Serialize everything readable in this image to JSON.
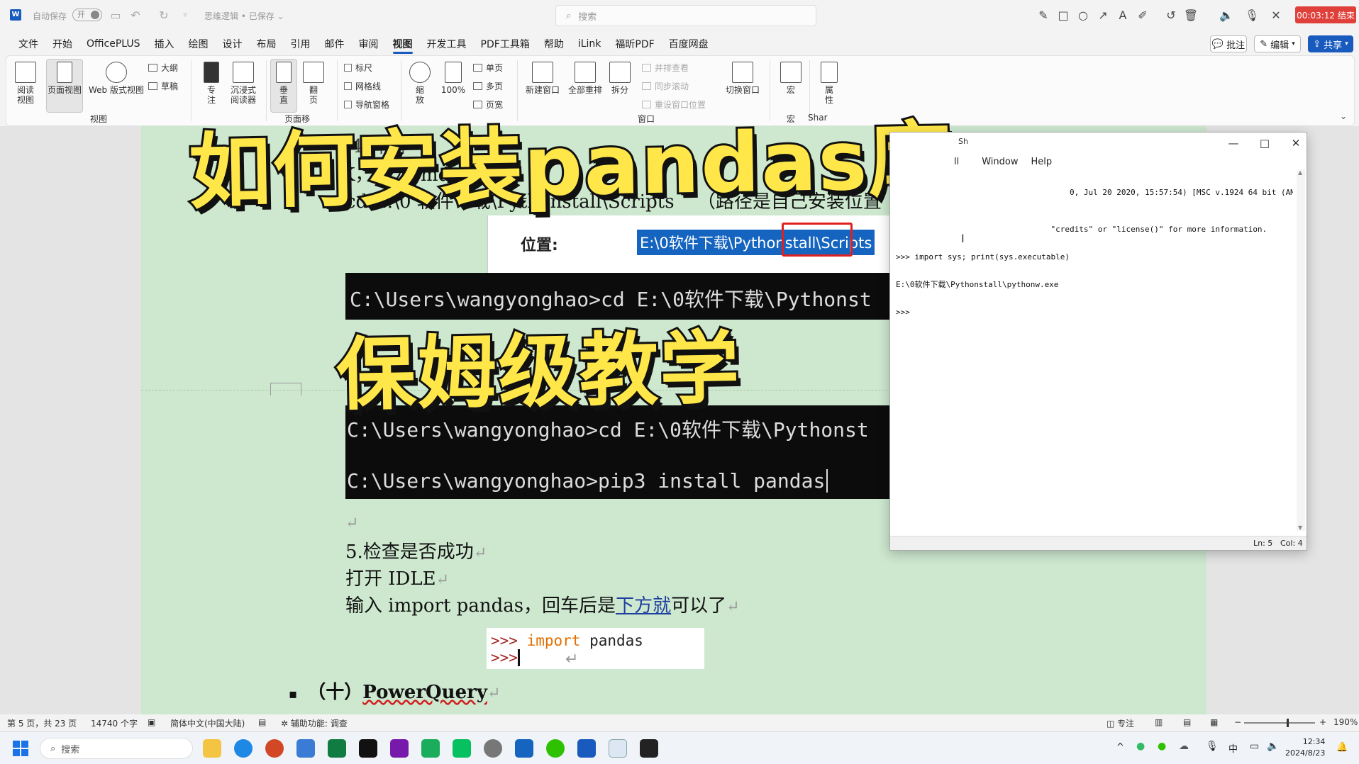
{
  "titlebar": {
    "autosave_label": "自动保存",
    "autosave_toggle": "开",
    "doc_title": "思维逻辑 • 已保存 ⌄",
    "search_placeholder": "搜索",
    "recording_timer": "00:03:12 结束"
  },
  "menu": {
    "items": [
      "文件",
      "开始",
      "OfficePLUS",
      "插入",
      "绘图",
      "设计",
      "布局",
      "引用",
      "邮件",
      "审阅",
      "视图",
      "开发工具",
      "PDF工具箱",
      "帮助",
      "iLink",
      "福昕PDF",
      "百度网盘"
    ],
    "active": "视图",
    "comment_btn": "批注",
    "edit_btn": "编辑",
    "share_btn": "共享"
  },
  "ribbon": {
    "read_view": "阅读\n视图",
    "page_view": "页面视图",
    "web_view": "Web 版式视图",
    "outline": "大纲",
    "draft": "草稿",
    "group_view": "视图",
    "focus": "专\n注",
    "immersive": "沉浸式\n阅读器",
    "vertical": "垂\n直",
    "page_flip": "翻\n页",
    "group_page_move": "页面移",
    "ruler": "标尺",
    "gridlines": "网格线",
    "nav_pane": "导航窗格",
    "zoom": "缩\n放",
    "zoom100": "100%",
    "one_page": "单页",
    "multi_page": "多页",
    "page_width": "页宽",
    "new_window": "新建窗口",
    "arrange_all": "全部重排",
    "split": "拆分",
    "side_by_side": "并排查看",
    "sync_scroll": "同步滚动",
    "reset_window": "重设窗口位置",
    "switch_window": "切换窗口",
    "group_window": "窗口",
    "macros": "宏",
    "group_macros": "宏",
    "properties": "属\n性",
    "group_share": "Shar"
  },
  "document": {
    "line_cmd": "cd E:\\0 软件下载\\Pythonstall\\Scripts",
    "line_cmd_note": "（路径是自己安装位置",
    "line_top_a": "4.开始",
    "line_top_b": "K，输入cmd",
    "location_label": "位置:",
    "location_path": "E:\\0软件下载\\Pythonstall\\Scripts",
    "term1_line": "C:\\Users\\wangyonghao>cd E:\\0软件下载\\Pythonst",
    "term2_line1": "C:\\Users\\wangyonghao>cd E:\\0软件下载\\Pythonst",
    "term2_line2": "C:\\Users\\wangyonghao>pip3 install pandas",
    "step5": "5.检查是否成功",
    "open_idle": "打开 IDLE",
    "input_line_a": "输入 import pandas，回车后是",
    "input_line_link": "下方就",
    "input_line_b": "可以了",
    "idle_prompt1": ">>> ",
    "idle_kw": "import",
    "idle_mod": " pandas",
    "idle_prompt2": ">>> ",
    "heading10_a": "（十）",
    "heading10_b": "PowerQuery",
    "bullet": "▪",
    "ret": "↵"
  },
  "overlay": {
    "title1": "如何安装pandas库",
    "title2": "保姆级教学"
  },
  "idle": {
    "title_frag": "Sh",
    "menu_items": [
      "ll",
      "Window",
      "Help"
    ],
    "line1": "                                     0, Jul 20 2020, 15:57:54) [MSC v.1924 64 bit (AM",
    "line2": "                                 \"credits\" or \"license()\" for more information.",
    "line3": ">>> import sys; print(sys.executable)",
    "line4": "E:\\0软件下载\\Pythonstall\\pythonw.exe",
    "line5": ">>> ",
    "status_ln": "Ln: 5",
    "status_col": "Col: 4"
  },
  "statusbar": {
    "page": "第 5 页，共 23 页",
    "words": "14740 个字",
    "lang": "简体中文(中国大陆)",
    "accessibility": "辅助功能: 调查",
    "focus": "专注",
    "zoom": "190%"
  },
  "taskbar": {
    "search": "搜索",
    "time": "12:34",
    "date": "2024/8/23",
    "ime": "中"
  },
  "colors": {
    "page_bg": "#cde8cf",
    "accent": "#185abd",
    "overlay_yellow": "#ffe74a",
    "timer_red": "#e0403a"
  }
}
